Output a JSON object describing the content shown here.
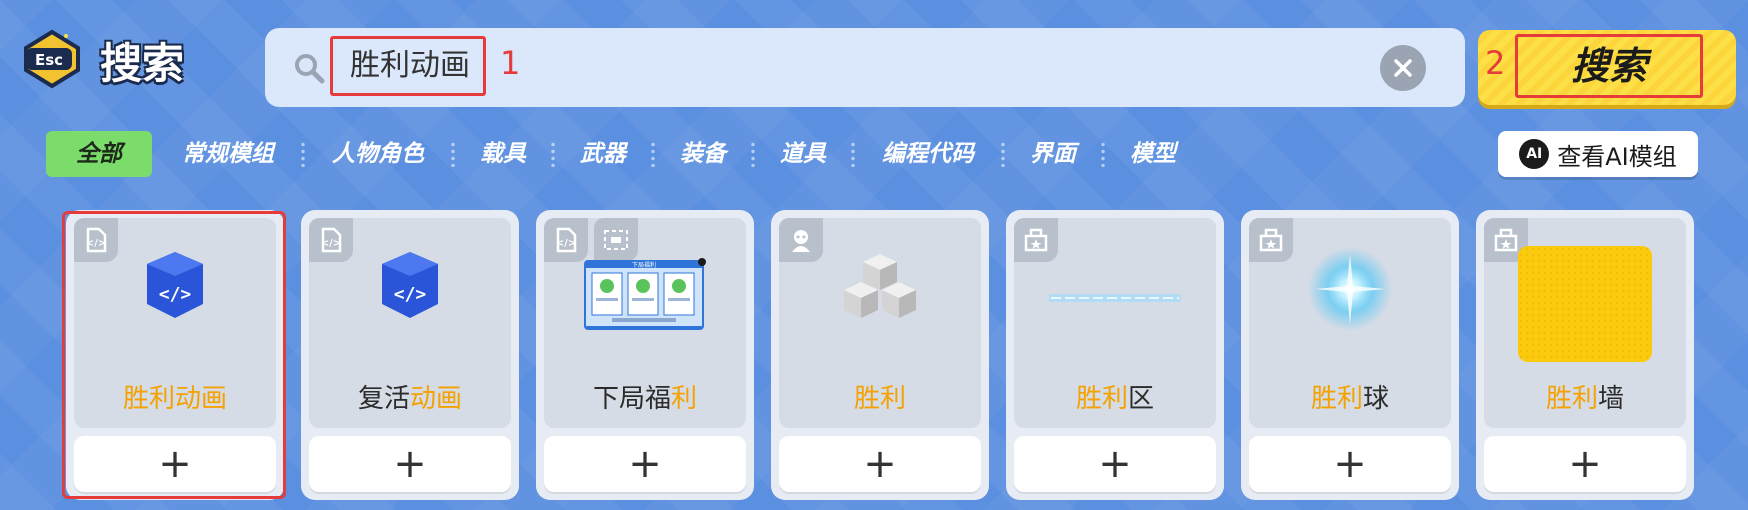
{
  "header": {
    "esc_label": "Esc",
    "title": "搜索",
    "search_value": "胜利动画",
    "annotation_1": "1",
    "annotation_2": "2",
    "search_button_label": "搜索"
  },
  "tabs": [
    {
      "label": "全部",
      "active": true
    },
    {
      "label": "常规模组",
      "active": false
    },
    {
      "label": "人物角色",
      "active": false
    },
    {
      "label": "载具",
      "active": false
    },
    {
      "label": "武器",
      "active": false
    },
    {
      "label": "装备",
      "active": false
    },
    {
      "label": "道具",
      "active": false
    },
    {
      "label": "编程代码",
      "active": false
    },
    {
      "label": "界面",
      "active": false
    },
    {
      "label": "模型",
      "active": false
    }
  ],
  "ai_button": {
    "badge": "AI",
    "label": "查看AI模组"
  },
  "cards": [
    {
      "title_plain": "",
      "title_highlight": "胜利动画",
      "title_suffix": "",
      "icon": "code-cube-icon",
      "badge": "code-icon",
      "selected": true
    },
    {
      "title_plain": "复活",
      "title_highlight": "动画",
      "title_suffix": "",
      "icon": "code-cube-icon",
      "badge": "code-icon",
      "selected": false
    },
    {
      "title_plain": "下局福",
      "title_highlight": "利",
      "title_suffix": "",
      "icon": "ui-panel-preview",
      "badge": "code-icon",
      "selected": false
    },
    {
      "title_plain": "",
      "title_highlight": "胜利",
      "title_suffix": "",
      "icon": "cube-stack-icon",
      "badge": "character-icon",
      "selected": false
    },
    {
      "title_plain": "",
      "title_highlight": "胜利",
      "title_suffix": "区",
      "icon": "light-strip-icon",
      "badge": "prop-icon",
      "selected": false
    },
    {
      "title_plain": "",
      "title_highlight": "胜利",
      "title_suffix": "球",
      "icon": "glow-orb-icon",
      "badge": "prop-icon",
      "selected": false
    },
    {
      "title_plain": "",
      "title_highlight": "胜利",
      "title_suffix": "墙",
      "icon": "yellow-wall-icon",
      "badge": "prop-icon",
      "selected": false
    }
  ],
  "add_label": "+",
  "preview_panel_title": "下局福利",
  "colors": {
    "accent_orange": "#f5a100",
    "highlight_red": "#e53b3b",
    "tab_active": "#7bdc6b",
    "search_button": "#fde048"
  }
}
